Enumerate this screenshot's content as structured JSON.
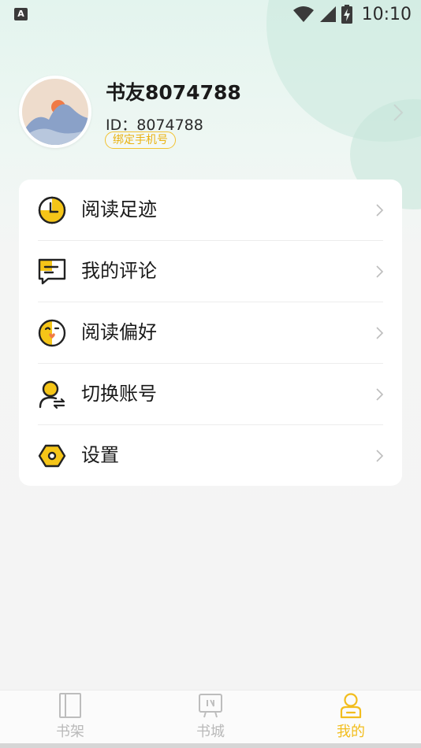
{
  "status_bar": {
    "app_icon_letter": "A",
    "time": "10:10"
  },
  "profile": {
    "username": "书友8074788",
    "id_text": "ID：8074788",
    "bind_phone_label": "绑定手机号"
  },
  "menu": {
    "items": [
      {
        "label": "阅读足迹",
        "icon": "clock-icon"
      },
      {
        "label": "我的评论",
        "icon": "comment-icon"
      },
      {
        "label": "阅读偏好",
        "icon": "smiley-heart-icon"
      },
      {
        "label": "切换账号",
        "icon": "switch-account-icon"
      },
      {
        "label": "设置",
        "icon": "settings-hexagon-icon"
      }
    ]
  },
  "tabs": [
    {
      "label": "书架",
      "icon": "bookshelf-icon",
      "active": false
    },
    {
      "label": "书城",
      "icon": "bookstore-icon",
      "active": false
    },
    {
      "label": "我的",
      "icon": "profile-icon",
      "active": true
    }
  ],
  "colors": {
    "accent": "#f2bd1d",
    "inactive_tab": "#b9b9b9",
    "icon_stroke": "#222222"
  }
}
